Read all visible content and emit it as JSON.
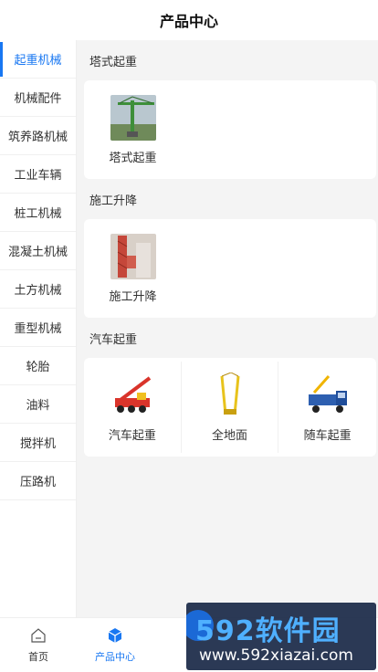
{
  "header": {
    "title": "产品中心"
  },
  "sidebar": {
    "items": [
      {
        "label": "起重机械",
        "active": true
      },
      {
        "label": "机械配件"
      },
      {
        "label": "筑养路机械"
      },
      {
        "label": "工业车辆"
      },
      {
        "label": "桩工机械"
      },
      {
        "label": "混凝土机械"
      },
      {
        "label": "土方机械"
      },
      {
        "label": "重型机械"
      },
      {
        "label": "轮胎"
      },
      {
        "label": "油料"
      },
      {
        "label": "搅拌机"
      },
      {
        "label": "压路机"
      }
    ]
  },
  "sections": [
    {
      "title": "塔式起重",
      "items": [
        {
          "label": "塔式起重",
          "icon": "tower-crane-photo"
        }
      ]
    },
    {
      "title": "施工升降",
      "items": [
        {
          "label": "施工升降",
          "icon": "construction-hoist-photo"
        }
      ]
    },
    {
      "title": "汽车起重",
      "items": [
        {
          "label": "汽车起重",
          "icon": "truck-crane-photo"
        },
        {
          "label": "全地面",
          "icon": "all-terrain-crane-photo"
        },
        {
          "label": "随车起重",
          "icon": "truck-mounted-crane-photo"
        }
      ]
    }
  ],
  "tabbar": {
    "tabs": [
      {
        "label": "首页",
        "icon": "home-icon"
      },
      {
        "label": "产品中心",
        "icon": "cube-icon",
        "active": true
      }
    ]
  },
  "watermark": {
    "brand": "592软件园",
    "url": "www.592xiazai.com"
  },
  "colors": {
    "accent": "#1877f2",
    "background": "#f4f4f4"
  }
}
